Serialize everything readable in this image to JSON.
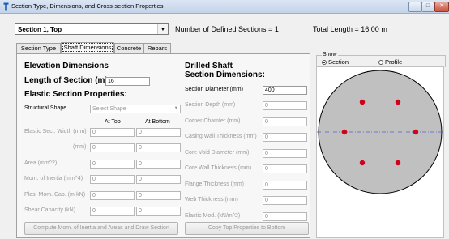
{
  "window": {
    "title": "Section Type, Dimensions, and Cross-section Properties",
    "buttons": {
      "minimize": "–",
      "maximize": "□",
      "close": "✕"
    }
  },
  "section_select": {
    "value": "Section 1, Top"
  },
  "info": {
    "num_sections": "Number of Defined Sections = 1",
    "total_length": "Total Length = 16.00 m"
  },
  "tabs": [
    "Section Type",
    "Shaft Dimensions",
    "Concrete",
    "Rebars"
  ],
  "active_tab": "Shaft Dimensions",
  "elevation": {
    "heading": "Elevation Dimensions",
    "length_label": "Length of Section (m)",
    "length_value": "16"
  },
  "elastic": {
    "heading": "Elastic Section Properties:",
    "shape_label": "Structural Shape",
    "shape_placeholder": "Select Shape",
    "col_top": "At Top",
    "col_bottom": "At Bottom",
    "rows": [
      {
        "label": "Elastic Sect. Width (mm)",
        "top": "0",
        "bottom": "0"
      },
      {
        "label": "(mm)",
        "top": "0",
        "bottom": "0"
      },
      {
        "label": "Area (mm^2)",
        "top": "0",
        "bottom": "0"
      },
      {
        "label": "Mom. of Inertia (mm^4)",
        "top": "0",
        "bottom": "0"
      },
      {
        "label": "Plas. Mom. Cap. (m-kN)",
        "top": "0",
        "bottom": "0"
      },
      {
        "label": "Shear Capacity (kN)",
        "top": "0",
        "bottom": "0"
      }
    ]
  },
  "drilled": {
    "heading_line1": "Drilled Shaft",
    "heading_line2": "Section Dimensions:",
    "rows": [
      {
        "label": "Section Diameter (mm)",
        "value": "400",
        "enabled": true
      },
      {
        "label": "Section Depth (mm)",
        "value": "0",
        "enabled": false
      },
      {
        "label": "Corner Chamfer (mm)",
        "value": "0",
        "enabled": false
      },
      {
        "label": "Casing Wall Thickness (mm)",
        "value": "0",
        "enabled": false
      },
      {
        "label": "Core Void Diameter (mm)",
        "value": "0",
        "enabled": false
      },
      {
        "label": "Core Wall Thickness (mm)",
        "value": "0",
        "enabled": false
      },
      {
        "label": "Flange Thickness (mm)",
        "value": "0",
        "enabled": false
      },
      {
        "label": "Web Thickness (mm)",
        "value": "0",
        "enabled": false
      },
      {
        "label": "Elastic Mod. (kN/m^2)",
        "value": "0",
        "enabled": false
      }
    ]
  },
  "buttons": {
    "compute": "Compute Mom. of Inertia and Areas and Draw Section",
    "copy": "Copy Top Properties to Bottom"
  },
  "show": {
    "legend": "Show",
    "option_section": "Section",
    "option_profile": "Profile",
    "selected": "Section"
  },
  "colors": {
    "section_fill": "#c0c0c0",
    "rebar": "#d0021b",
    "axis": "#4a5fd4"
  }
}
